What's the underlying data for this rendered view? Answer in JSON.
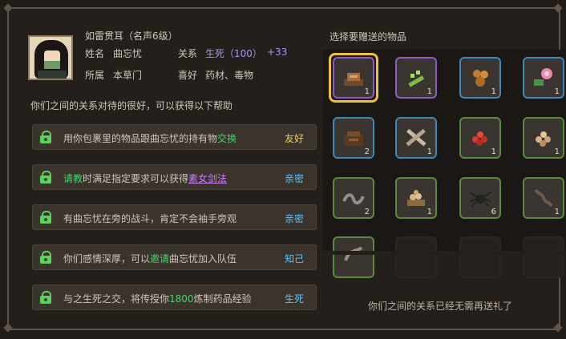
{
  "npc": {
    "title": "如雷贯耳（名声6级）",
    "name_label": "姓名",
    "name": "曲忘忧",
    "relation_label": "关系",
    "relation": "生死（100）",
    "relation_gain": "+33",
    "faction_label": "所属",
    "faction": "本草门",
    "hobby_label": "喜好",
    "hobby": "药材、毒物"
  },
  "help": {
    "intro": "你们之间的关系对待的很好，可以获得以下帮助",
    "rows": [
      {
        "p1": "用你包裹里的物品跟曲忘忧的持有物",
        "link": "交换",
        "p2": "",
        "tag": "友好"
      },
      {
        "p1": "",
        "link": "请教",
        "p2": "时满足指定要求可以获得",
        "skill": "素女剑法",
        "tag": "亲密"
      },
      {
        "p1": "有曲忘忧在旁的战斗，肯定不会袖手旁观",
        "tag": "亲密"
      },
      {
        "p1": "你们感情深厚，可以",
        "link": "邀请",
        "p2": "曲忘忧加入队伍",
        "tag": "知己"
      },
      {
        "p1": "与之生死之交，将传授你",
        "num": "1800",
        "p2": "炼制药品经验",
        "tag": "生死"
      }
    ]
  },
  "gift": {
    "title": "选择要赠送的物品",
    "notice": "你们之间的关系已经无需再送礼了",
    "items": [
      {
        "name": "dried-meat",
        "qty": "1",
        "rarity": "purple"
      },
      {
        "name": "green-herb",
        "qty": "1",
        "rarity": "purple"
      },
      {
        "name": "nuts",
        "qty": "1",
        "rarity": "blue"
      },
      {
        "name": "lotus-flower",
        "qty": "1",
        "rarity": "blue"
      },
      {
        "name": "chocolate",
        "qty": "2",
        "rarity": "blue"
      },
      {
        "name": "crossed-sticks",
        "qty": "1",
        "rarity": "blue"
      },
      {
        "name": "red-berries",
        "qty": "1",
        "rarity": "green"
      },
      {
        "name": "mushrooms",
        "qty": "1",
        "rarity": "green"
      },
      {
        "name": "worm",
        "qty": "2",
        "rarity": "green"
      },
      {
        "name": "grain",
        "qty": "1",
        "rarity": "green"
      },
      {
        "name": "spider",
        "qty": "6",
        "rarity": "green"
      },
      {
        "name": "centipede",
        "qty": "1",
        "rarity": "green"
      },
      {
        "name": "snake",
        "qty": "",
        "rarity": "green"
      }
    ]
  }
}
